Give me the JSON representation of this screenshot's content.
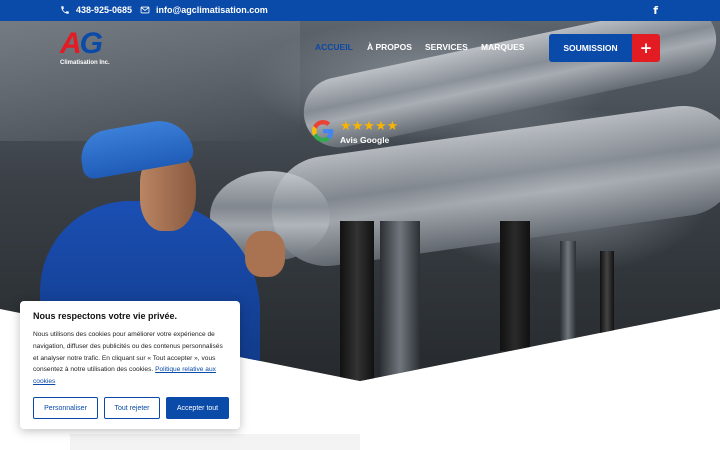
{
  "topbar": {
    "phone": "438-925-0685",
    "email": "info@agclimatisation.com",
    "facebook": "f"
  },
  "logo": {
    "letter_a": "A",
    "letter_g": "G",
    "subtitle": "Climatisation Inc."
  },
  "nav": {
    "items": [
      {
        "label": "ACCUEIL",
        "active": true
      },
      {
        "label": "À PROPOS"
      },
      {
        "label": "SERVICES"
      },
      {
        "label": "MARQUES"
      }
    ],
    "cta_label": "SOUMISSION",
    "cta_plus": "+"
  },
  "reviews": {
    "stars": "★★★★★",
    "label": "Avis Google",
    "rating": 5
  },
  "cookie": {
    "title": "Nous respectons votre vie privée.",
    "text": "Nous utilisons des cookies pour améliorer votre expérience de navigation, diffuser des publicités ou des contenus personnalisés et analyser notre trafic. En cliquant sur « Tout accepter », vous consentez à notre utilisation des cookies.",
    "policy_link": "Politique relative aux cookies",
    "customize_label": "Personnaliser",
    "reject_label": "Tout rejeter",
    "accept_label": "Accepter tout"
  },
  "colors": {
    "brand_blue": "#0a4aa8",
    "brand_red": "#e31b23",
    "star": "#f7b400"
  },
  "icons": {
    "phone": "phone-icon",
    "email": "mail-icon",
    "facebook": "facebook-icon",
    "google": "google-icon"
  }
}
